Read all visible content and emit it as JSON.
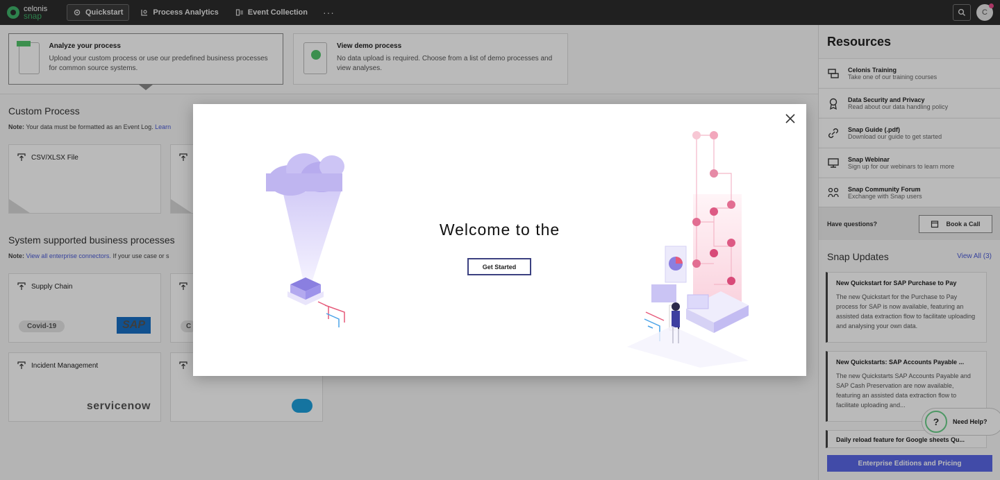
{
  "topbar": {
    "logo_line1": "celonis",
    "logo_line2": "snap",
    "nav": [
      {
        "label": "Quickstart"
      },
      {
        "label": "Process Analytics"
      },
      {
        "label": "Event Collection"
      }
    ],
    "more": "···",
    "avatar_initial": "C"
  },
  "hero": {
    "cards": [
      {
        "title": "Analyze your process",
        "desc": "Upload your custom process or use our predefined business processes for common source systems."
      },
      {
        "title": "View demo process",
        "desc": "No data upload is required. Choose from a list of demo processes and view analyses."
      }
    ]
  },
  "custom": {
    "title": "Custom Process",
    "note_bold": "Note:",
    "note_text": "Your data must be formatted as an Event Log.",
    "note_link": "Learn",
    "tiles": [
      {
        "label": "CSV/XLSX File"
      }
    ]
  },
  "system": {
    "title": "System supported business processes",
    "note_bold": "Note:",
    "note_link": "View all enterprise connectors.",
    "note_text": "If your use case or s",
    "tiles": [
      {
        "label": "Supply Chain",
        "badge": "Covid-19",
        "brand": "SAP"
      },
      {
        "label": "Incident Management",
        "brand": "servicenow"
      }
    ],
    "partial_badge": "C"
  },
  "modal": {
    "welcome": "Welcome to the",
    "button": "Get Started"
  },
  "sidebar": {
    "title": "Resources",
    "resources": [
      {
        "title": "Celonis Training",
        "desc": "Take one of our training courses",
        "icon": "training-icon"
      },
      {
        "title": "Data Security and Privacy",
        "desc": "Read about our data handling policy",
        "icon": "award-icon"
      },
      {
        "title": "Snap Guide (.pdf)",
        "desc": "Download our guide to get started",
        "icon": "link-icon"
      },
      {
        "title": "Snap Webinar",
        "desc": "Sign up for our webinars to learn more",
        "icon": "monitor-icon"
      },
      {
        "title": "Snap Community Forum",
        "desc": "Exchange with Snap users",
        "icon": "community-icon"
      }
    ],
    "questions": "Have questions?",
    "book_call": "Book a Call",
    "updates_title": "Snap Updates",
    "view_all": "View All (3)",
    "updates": [
      {
        "title": "New Quickstart for SAP Purchase to Pay",
        "desc": "The new Quickstart for the Purchase to Pay process for SAP is now available, featuring an assisted data extraction flow to facilitate uploading and analysing your own data."
      },
      {
        "title": "New Quickstarts: SAP Accounts Payable ...",
        "desc": "The new Quickstarts SAP Accounts Payable and SAP Cash Preservation are now available, featuring an assisted data extraction flow to facilitate uploading and..."
      },
      {
        "title": "Daily reload feature for Google sheets Qu...",
        "desc": ""
      }
    ],
    "need_help": "Need Help?",
    "enterprise": "Enterprise Editions and Pricing"
  }
}
